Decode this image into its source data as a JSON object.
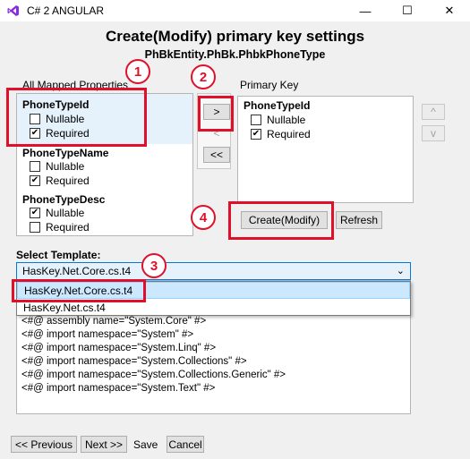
{
  "window": {
    "title": "C# 2 ANGULAR",
    "minimize": "—",
    "maximize": "☐",
    "close": "✕"
  },
  "header": {
    "title": "Create(Modify) primary key settings",
    "subtitle": "PhBkEntity.PhBk.PhbkPhoneType"
  },
  "left_panel": {
    "label": "All Mapped Properties",
    "items": [
      {
        "name": "PhoneTypeId",
        "nullable_label": "Nullable",
        "nullable": false,
        "required_label": "Required",
        "required": true
      },
      {
        "name": "PhoneTypeName",
        "nullable_label": "Nullable",
        "nullable": false,
        "required_label": "Required",
        "required": true
      },
      {
        "name": "PhoneTypeDesc",
        "nullable_label": "Nullable",
        "nullable": true,
        "required_label": "Required",
        "required": false
      }
    ]
  },
  "move_buttons": {
    "add": ">",
    "remove": "<",
    "remove_all": "<<"
  },
  "right_panel": {
    "label": "Primary Key",
    "items": [
      {
        "name": "PhoneTypeId",
        "nullable_label": "Nullable",
        "nullable": false,
        "required_label": "Required",
        "required": true
      }
    ]
  },
  "order_buttons": {
    "up": "^",
    "down": "v"
  },
  "actions": {
    "create": "Create(Modify)",
    "refresh": "Refresh"
  },
  "template": {
    "label": "Select Template:",
    "selected": "HasKey.Net.Core.cs.t4",
    "options": [
      "HasKey.Net.Core.cs.t4",
      "HasKey.Net.cs.t4"
    ]
  },
  "code_lines": [
    "<#@ assembly name=\"System.Core\" #>",
    "<#@ import namespace=\"System\" #>",
    "<#@ import namespace=\"System.Linq\" #>",
    "<#@ import namespace=\"System.Collections\" #>",
    "<#@ import namespace=\"System.Collections.Generic\" #>",
    "<#@ import namespace=\"System.Text\" #>"
  ],
  "annotations": [
    "1",
    "2",
    "3",
    "4"
  ],
  "nav": {
    "previous": "<< Previous",
    "next": "Next >>",
    "save": "Save",
    "cancel": "Cancel"
  },
  "colors": {
    "annotation": "#e0102a",
    "selection": "#cce8ff",
    "accent": "#0078d7"
  }
}
